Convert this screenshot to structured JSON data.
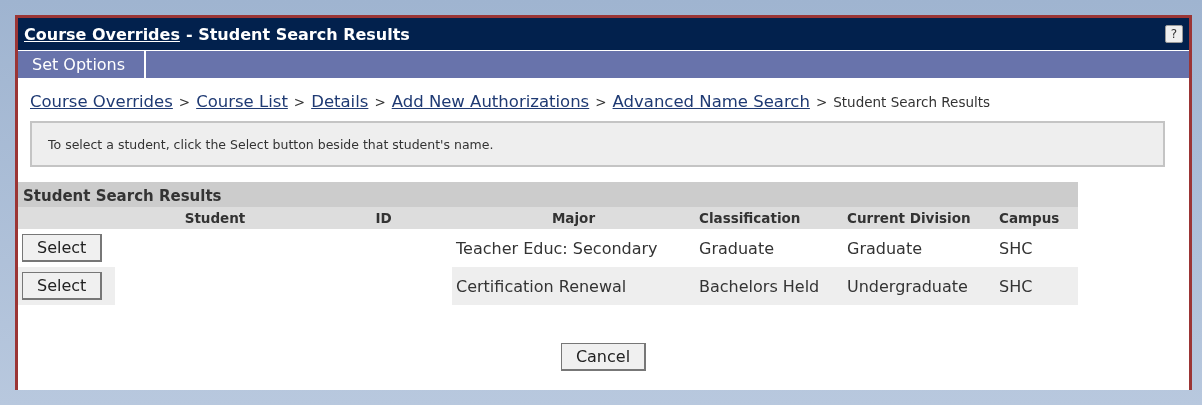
{
  "title_bar": {
    "link": "Course Overrides",
    "rest": "- Student Search Results",
    "help": "?"
  },
  "options_bar": {
    "tabs": [
      {
        "label": "Set Options"
      }
    ]
  },
  "breadcrumb": [
    {
      "kind": "link",
      "label": "Course Overrides"
    },
    {
      "kind": "separator",
      "label": ">"
    },
    {
      "kind": "link",
      "label": "Course List"
    },
    {
      "kind": "separator",
      "label": ">"
    },
    {
      "kind": "link",
      "label": "Details"
    },
    {
      "kind": "separator",
      "label": ">"
    },
    {
      "kind": "link",
      "label": "Add New Authorizations"
    },
    {
      "kind": "separator",
      "label": ">"
    },
    {
      "kind": "link",
      "label": "Advanced Name Search"
    },
    {
      "kind": "separator",
      "label": ">"
    },
    {
      "kind": "current",
      "label": "Student Search Results"
    }
  ],
  "instruction": "To select a student, click the Select button beside that student's name.",
  "table": {
    "title": "Student Search Results",
    "columns": [
      "Student",
      "ID",
      "Major",
      "Classification",
      "Current Division",
      "Campus"
    ],
    "rows": [
      {
        "action": "Select",
        "major": "Teacher Educ: Secondary",
        "classification": "Graduate",
        "division": "Graduate",
        "campus": "SHC"
      },
      {
        "action": "Select",
        "major": "Certification Renewal",
        "classification": "Bachelors Held",
        "division": "Undergraduate",
        "campus": "SHC"
      }
    ]
  },
  "cancel": "Cancel"
}
